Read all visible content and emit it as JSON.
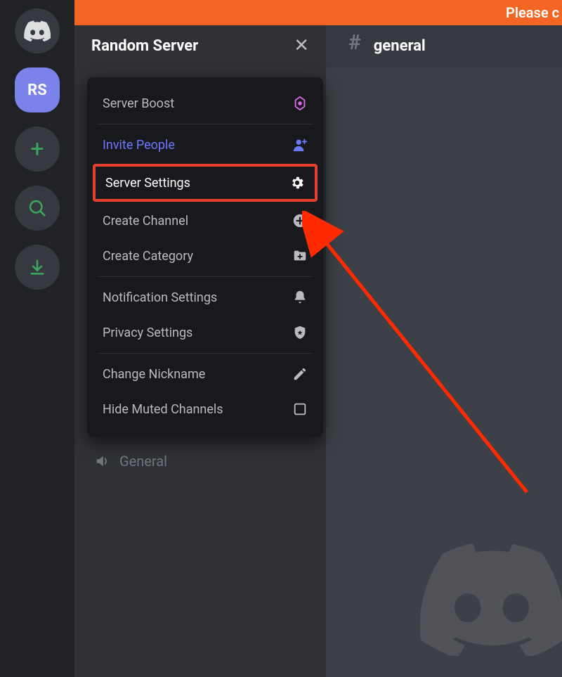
{
  "banner": {
    "text": "Please c"
  },
  "rail": {
    "selected_server_initials": "RS"
  },
  "channels": {
    "server_name": "Random Server",
    "voice_channel": "General"
  },
  "dropdown": {
    "items": [
      {
        "label": "Server Boost",
        "icon": "boost-icon",
        "accent": "boost"
      },
      {
        "sep": true
      },
      {
        "label": "Invite People",
        "icon": "invite-icon",
        "accent": "invite"
      },
      {
        "label": "Server Settings",
        "icon": "gear-icon",
        "accent": "highlight"
      },
      {
        "label": "Create Channel",
        "icon": "plus-circle-icon"
      },
      {
        "label": "Create Category",
        "icon": "folder-plus-icon"
      },
      {
        "sep": true
      },
      {
        "label": "Notification Settings",
        "icon": "bell-icon"
      },
      {
        "label": "Privacy Settings",
        "icon": "shield-icon"
      },
      {
        "sep": true
      },
      {
        "label": "Change Nickname",
        "icon": "pencil-icon"
      },
      {
        "label": "Hide Muted Channels",
        "icon": "checkbox-icon"
      }
    ]
  },
  "main": {
    "channel_name": "general"
  },
  "colors": {
    "banner": "#f26522",
    "highlight_border": "#e53e2e",
    "invite": "#6d78ff",
    "boost": "#d96be6",
    "rail_accent": "#3ba55d"
  }
}
